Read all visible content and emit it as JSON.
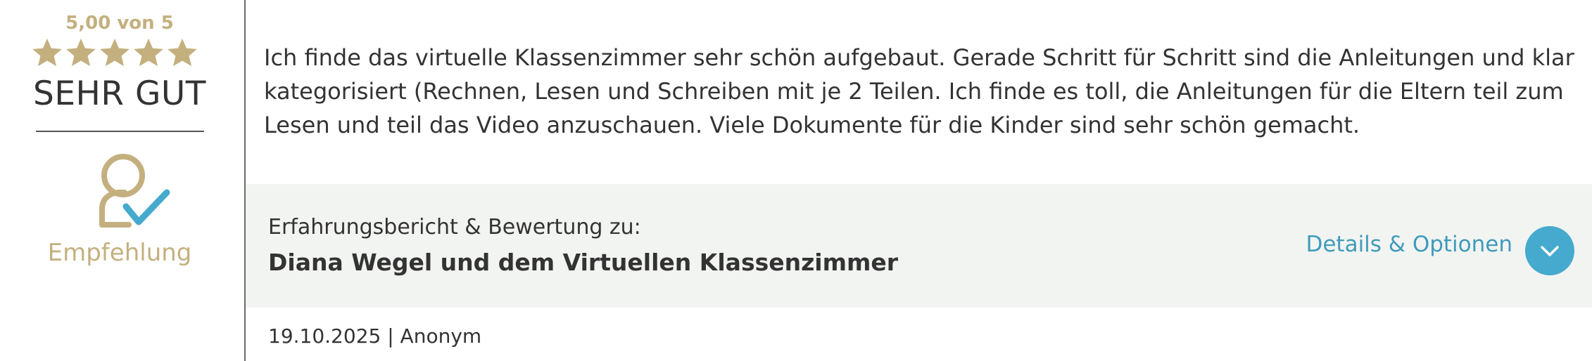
{
  "rating": {
    "score_text": "5,00 von 5",
    "stars_filled": 5,
    "stars_total": 5,
    "label": "SEHR GUT"
  },
  "recommendation": {
    "icon": "user-check-icon",
    "label": "Empfehlung"
  },
  "review": {
    "text": "Ich finde das virtuelle Klassenzimmer sehr schön aufgebaut. Gerade Schritt für Schritt sind die Anleitungen und klar kategorisiert (Rechnen, Lesen und Schreiben mit je 2 Teilen. Ich finde es toll, die Anleitungen für die Eltern teil zum Lesen und teil das Video anzuschauen. Viele Dokumente für die Kinder sind sehr schön gemacht."
  },
  "subject": {
    "prefix": "Erfahrungsbericht & Bewertung zu:",
    "title": "Diana Wegel und dem Virtuellen Klassenzimmer",
    "details_label": "Details & Optionen",
    "toggle_icon": "chevron-down-icon"
  },
  "meta": {
    "text": "19.10.2025 | Anonym"
  },
  "colors": {
    "gold": "#c4b07f",
    "accent_blue": "#45aacd",
    "link_blue": "#3f9bbb",
    "text": "#333333",
    "subject_bg": "#f2f4f2"
  }
}
